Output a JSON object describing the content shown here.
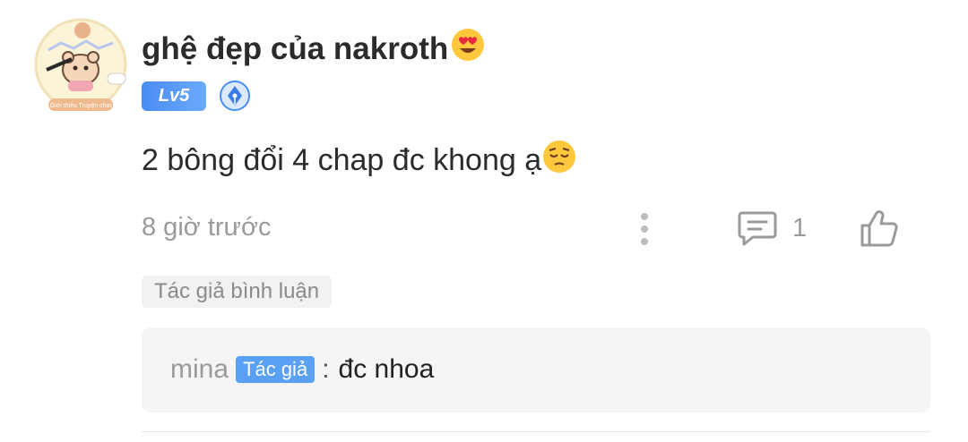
{
  "user": {
    "name": "ghệ đẹp của nakroth",
    "avatar_caption": "Giới thiệu Truyện chat",
    "level": "Lv5",
    "name_emoji_icon": "heart-eyes-emoji-icon",
    "writer_badge_icon": "pen-nib-badge-icon"
  },
  "comment": {
    "text": "2 bông đổi 4 chap đc khong ạ",
    "emoji_icon": "pensive-emoji-icon",
    "time": "8 giờ trước",
    "reply_count": "1"
  },
  "author_replied_tag": "Tác giả bình luận",
  "reply": {
    "author": "mina",
    "badge": "Tác giả",
    "separator": ":",
    "text": "đc nhoa"
  },
  "colors": {
    "accent_blue": "#4a8df5",
    "muted_gray": "#9a9a9a",
    "reply_bg": "#f5f5f5"
  }
}
